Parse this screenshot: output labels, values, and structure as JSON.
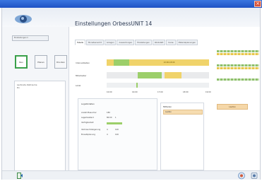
{
  "window": {
    "close_glyph": "×"
  },
  "header": {
    "title": "Einstellungen OrbessUNIT 14",
    "logo_icon": "app-logo-icon"
  },
  "sidebar": {
    "dropdown_value": "Einstellungen ▾",
    "buttons": [
      {
        "label": "Neu",
        "active": true
      },
      {
        "label": "Planen",
        "active": false
      },
      {
        "label": "Drucken",
        "active": false
      }
    ],
    "list": [
      "Laufende Zeitraume",
      "Do"
    ]
  },
  "tabs": [
    "Tabelle",
    "Monatsansicht",
    "Anlagen",
    "Auswertungen",
    "Einstellungen",
    "Werkstatt",
    "Kurse",
    "Materialplanungen"
  ],
  "timeline": {
    "rows": [
      {
        "label": "Intervallzeiten",
        "bar_label": "10:00-18:00"
      },
      {
        "label": "Mitarbeiter",
        "bar_label": ""
      },
      {
        "label": "Lokal",
        "bar_label": ""
      }
    ],
    "ticks": [
      "10:00",
      "16:00",
      "17:00",
      "18:00",
      "19:00"
    ]
  },
  "details": {
    "heading": "Logistikdaten",
    "rows": [
      {
        "label": "Anzahl Besucher",
        "v1": "180",
        "v2": ""
      },
      {
        "label": "Lagerbestand",
        "v1": "80:00",
        "v2": "1"
      },
      {
        "label": "Verfügbarkeit",
        "v1": "",
        "v2": ""
      },
      {
        "label": "Verbrauchsteigerung",
        "v1": "4",
        "v2": "100"
      },
      {
        "label": "Einsatzplanung",
        "v1": "4",
        "v2": "100"
      }
    ]
  },
  "mini_panel": {
    "heading": "Mitteilen",
    "value": "Laufen"
  },
  "action_button": {
    "label": "Laufen"
  },
  "status": {
    "left_icon": "exit-icon",
    "right_icons": [
      "help-icon",
      "settings-icon"
    ]
  }
}
